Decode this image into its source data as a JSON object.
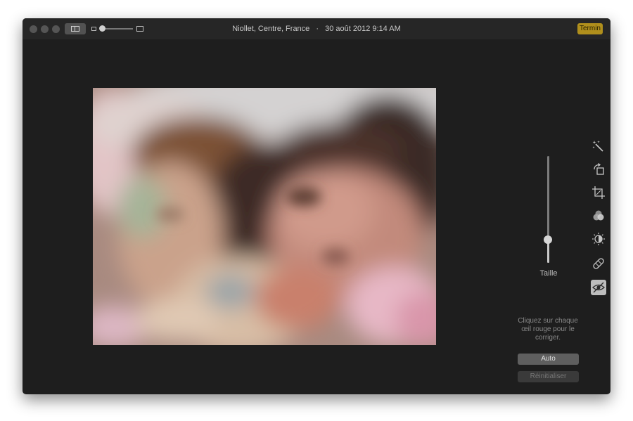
{
  "titlebar": {
    "location": "Niollet, Centre, France",
    "separator": "·",
    "datetime": "30 août 2012 9:14 AM",
    "done_label": "Termin",
    "done_color": "#b08f1c"
  },
  "photo": {
    "description_icon": "blurred-family-photo"
  },
  "side_panel": {
    "size_slider_label": "Taille",
    "size_slider_value_fraction": 0.17,
    "tools": [
      "magic-wand-icon",
      "rotate-icon",
      "crop-icon",
      "filters-icon",
      "adjust-icon",
      "retouch-bandage-icon",
      "red-eye-icon"
    ],
    "active_tool": "red-eye-icon",
    "hint_text": "Cliquez sur chaque œil rouge pour le corriger.",
    "auto_label": "Auto",
    "reset_label": "Réinitialiser"
  }
}
